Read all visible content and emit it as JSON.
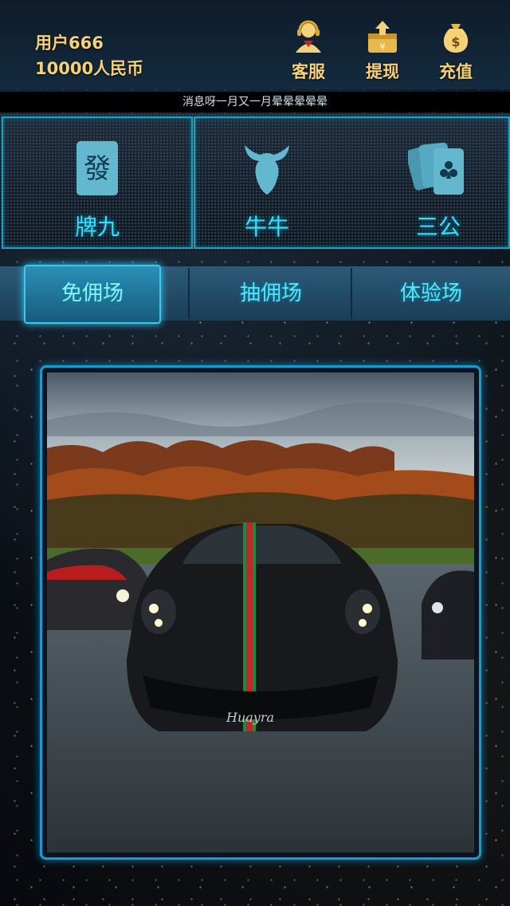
{
  "user": {
    "name": "用户666",
    "balance": "10000人民币"
  },
  "header": {
    "buttons": [
      {
        "label": "客服",
        "icon": "customer-service-icon"
      },
      {
        "label": "提现",
        "icon": "withdraw-icon"
      },
      {
        "label": "充值",
        "icon": "recharge-icon"
      }
    ]
  },
  "marquee": {
    "text": "消息呀一月又一月晕晕晕晕晕"
  },
  "games": [
    {
      "label": "牌九",
      "icon": "mahjong-tile-icon",
      "tile_char": "發"
    },
    {
      "label": "牛牛",
      "icon": "bull-head-icon"
    },
    {
      "label": "三公",
      "icon": "playing-cards-icon"
    }
  ],
  "tabs": [
    {
      "label": "免佣场",
      "active": true
    },
    {
      "label": "抽佣场",
      "active": false
    },
    {
      "label": "体验场",
      "active": false
    }
  ],
  "banner": {
    "car_badge": "Huayra"
  },
  "colors": {
    "gold": "#f5d27a",
    "cyan": "#35e0ff",
    "border": "#1a9bd0"
  }
}
